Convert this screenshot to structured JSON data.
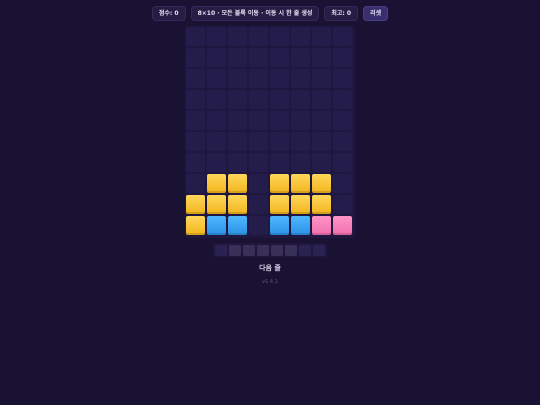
{
  "header": {
    "score_label": "점수: 0",
    "mode_label": "8×10 · 모든 블록 이동 · 이동 시 한 줄 생성",
    "best_label": "최고: 0",
    "reset_label": "리셋"
  },
  "board": {
    "columns": 8,
    "rows": 10,
    "blocks": [
      {
        "row": 7,
        "col": 1,
        "color": "yellow"
      },
      {
        "row": 7,
        "col": 2,
        "color": "yellow"
      },
      {
        "row": 7,
        "col": 4,
        "color": "yellow"
      },
      {
        "row": 7,
        "col": 5,
        "color": "yellow"
      },
      {
        "row": 7,
        "col": 6,
        "color": "yellow"
      },
      {
        "row": 8,
        "col": 0,
        "color": "yellow"
      },
      {
        "row": 8,
        "col": 1,
        "color": "yellow"
      },
      {
        "row": 8,
        "col": 2,
        "color": "yellow"
      },
      {
        "row": 8,
        "col": 4,
        "color": "yellow"
      },
      {
        "row": 8,
        "col": 5,
        "color": "yellow"
      },
      {
        "row": 8,
        "col": 6,
        "color": "yellow"
      },
      {
        "row": 9,
        "col": 0,
        "color": "yellow"
      },
      {
        "row": 9,
        "col": 1,
        "color": "blue"
      },
      {
        "row": 9,
        "col": 2,
        "color": "blue"
      },
      {
        "row": 9,
        "col": 4,
        "color": "blue"
      },
      {
        "row": 9,
        "col": 5,
        "color": "blue"
      },
      {
        "row": 9,
        "col": 6,
        "color": "pink"
      },
      {
        "row": 9,
        "col": 7,
        "color": "pink"
      }
    ]
  },
  "next_row": {
    "filled": [
      false,
      true,
      true,
      true,
      true,
      true,
      false,
      false
    ],
    "label": "다음 줄"
  },
  "footer": {
    "version": "v1.4.1"
  },
  "colors": {
    "background": "#1a1233",
    "yellow": "#f7c532",
    "blue": "#3aa5f5",
    "pink": "#f882bd"
  }
}
